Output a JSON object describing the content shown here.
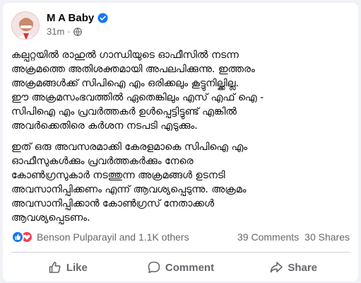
{
  "post": {
    "author_name": "M A Baby",
    "time": "31m",
    "verified_icon": "verified-badge-icon",
    "privacy_icon": "globe-icon",
    "paragraphs": [
      "കല്പറ്റയിൽ രാഹുൽ ഗാന്ധിയുടെ ഓഫീസിൽ നടന്ന\nഅക്രമത്തെ അതിശക്തമായി അപലപിക്കുന്നു. ഇത്തരം\nഅക്രമങ്ങൾക്ക് സിപിഐ എം ഒരിക്കലും കൂട്ടുനില്ക്കില്ല.\nഈ അക്രമസംഭവത്തിൽ ഏതെങ്കിലും എസ് എഫ് ഐ -\nസിപിഐ എം പ്രവർത്തകർ ഉൾപ്പെട്ടിട്ടുണ്ട് എങ്കിൽ\nഅവർക്കെതിരെ കർശന നടപടി എടുക്കും.",
      "ഇത് ഒരു അവസരമാക്കി കേരളമാകെ സിപിഐ എം\nഓഫീസുകൾക്കും പ്രവർത്തകർക്കും നേരെ\nകോൺഗ്രസുകാർ നടത്തുന്ന അക്രമങ്ങൾ ഉടനടി\nഅവസാനിപ്പിക്കണം എന്ന് ആവശ്യപ്പെടുന്നു. അക്രമം\nഅവസാനിപ്പിക്കാൻ കോൺഗ്രസ് നേതാക്കൾ\nആവശ്യപ്പെടണം."
    ]
  },
  "stats": {
    "reactions_label": "Benson Pulparayil and 1.1K others",
    "comments": "39 Comments",
    "shares": "30 Shares"
  },
  "actions": {
    "like": "Like",
    "comment": "Comment",
    "share": "Share"
  },
  "colors": {
    "brand_blue": "#1877f2",
    "love_red": "#f33e58",
    "secondary_text": "#65676b"
  }
}
